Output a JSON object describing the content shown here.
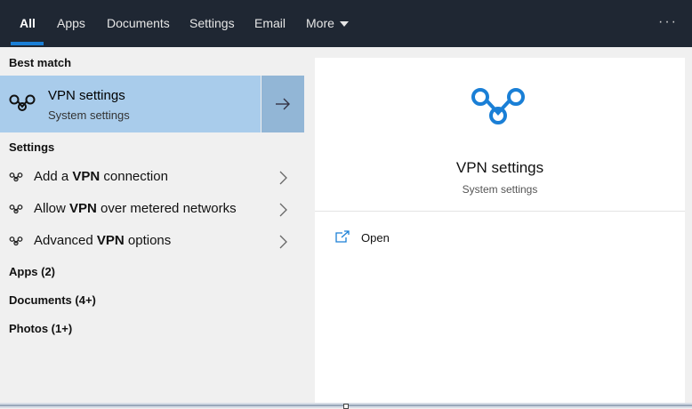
{
  "tabs": [
    {
      "label": "All",
      "active": true
    },
    {
      "label": "Apps"
    },
    {
      "label": "Documents"
    },
    {
      "label": "Settings"
    },
    {
      "label": "Email"
    },
    {
      "label": "More"
    }
  ],
  "more_options": "···",
  "best_match": {
    "heading": "Best match",
    "title": "VPN settings",
    "subtitle": "System settings",
    "icon": "vpn-icon",
    "arrow_icon": "arrow-right-icon"
  },
  "settings_section": {
    "heading": "Settings",
    "items": [
      {
        "pre": "Add a ",
        "bold": "VPN",
        "post": " connection"
      },
      {
        "pre": "Allow ",
        "bold": "VPN",
        "post": " over metered networks"
      },
      {
        "pre": "Advanced ",
        "bold": "VPN",
        "post": " options"
      }
    ]
  },
  "categories": [
    {
      "label": "Apps (2)"
    },
    {
      "label": "Documents (4+)"
    },
    {
      "label": "Photos (1+)"
    }
  ],
  "detail": {
    "title": "VPN settings",
    "subtitle": "System settings",
    "open_label": "Open",
    "open_icon": "open-external-icon"
  },
  "colors": {
    "topbar": "#1f2733",
    "accent": "#1a7fd6",
    "selected": "#a9cceb",
    "selected_arrow": "#92b6d6"
  }
}
